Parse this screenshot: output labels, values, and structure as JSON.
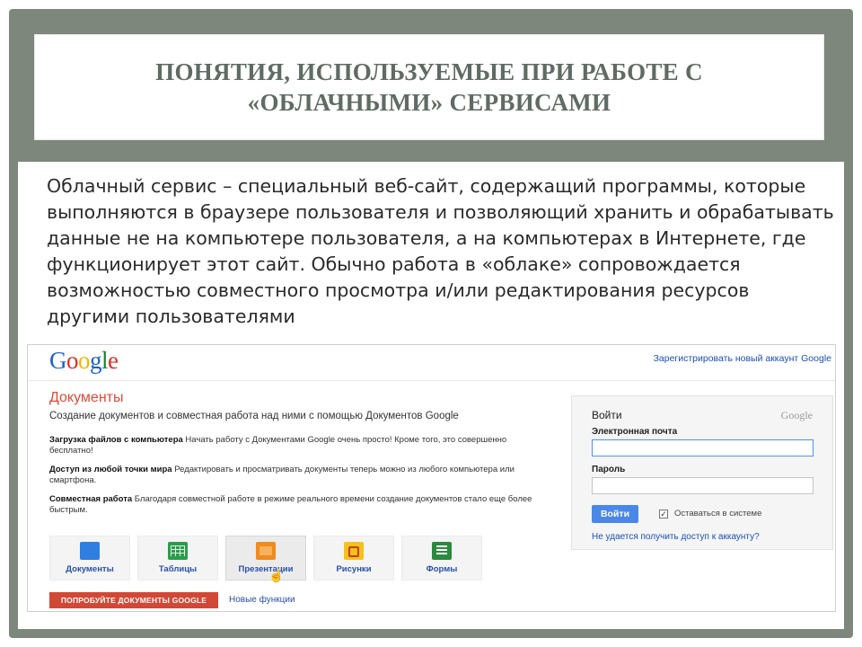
{
  "slide": {
    "title": "ПОНЯТИЯ, ИСПОЛЬЗУЕМЫЕ ПРИ РАБОТЕ С «ОБЛАЧНЫМИ» СЕРВИСАМИ",
    "body": "Облачный сервис – специальный веб-сайт, содержащий программы, которые выполняются в браузере пользователя и позволяющий хранить и обрабатывать данные не на компьютере пользователя, а на компьютерах в Интернете, где функционирует этот сайт. Обычно работа в «облаке» сопровождается возможностью совместного просмотра и/или редактирования ресурсов другими пользователями"
  },
  "google": {
    "logo": {
      "letters": [
        "G",
        "o",
        "o",
        "g",
        "l",
        "e"
      ],
      "colors": [
        "#1a5fd6",
        "#d93025",
        "#f4b400",
        "#1a5fd6",
        "#188038",
        "#d93025"
      ]
    },
    "register_link": "Зарегистрировать новый аккаунт Google",
    "docs_title": "Документы",
    "docs_subtitle": "Создание документов и совместная работа над ними с помощью Документов Google",
    "features": [
      {
        "title": "Загрузка файлов с компьютера",
        "text": " Начать работу с Документами Google очень просто! Кроме того, это совершенно бесплатно!"
      },
      {
        "title": "Доступ из любой точки мира",
        "text": " Редактировать и просматривать документы теперь можно из любого компьютера или смартфона."
      },
      {
        "title": "Совместная работа",
        "text": " Благодаря совместной работе в режиме реального времени создание документов стало еще более быстрым."
      }
    ],
    "apps": [
      {
        "label": "Документы",
        "icon": "docs-icon"
      },
      {
        "label": "Таблицы",
        "icon": "sheets-icon"
      },
      {
        "label": "Презентации",
        "icon": "slides-icon"
      },
      {
        "label": "Рисунки",
        "icon": "drawings-icon"
      },
      {
        "label": "Формы",
        "icon": "forms-icon"
      }
    ],
    "try_button": "ПОПРОБУЙТЕ ДОКУМЕНТЫ GOOGLE",
    "new_features": "Новые функции",
    "login": {
      "title": "Войти",
      "brand": "Google",
      "email_label": "Электронная почта",
      "email_value": "",
      "password_label": "Пароль",
      "password_value": "",
      "signin_button": "Войти",
      "remember_label": "Оставаться в системе",
      "remember_checked": "✓",
      "cant_access": "Не удается получить доступ к аккаунту?"
    }
  }
}
